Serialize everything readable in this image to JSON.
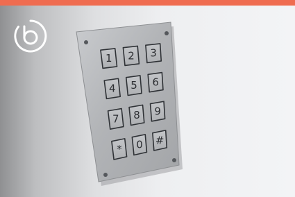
{
  "keypad": {
    "keys": [
      {
        "label": "1"
      },
      {
        "label": "2"
      },
      {
        "label": "3"
      },
      {
        "label": "4"
      },
      {
        "label": "5"
      },
      {
        "label": "6"
      },
      {
        "label": "7"
      },
      {
        "label": "8"
      },
      {
        "label": "9"
      },
      {
        "label": "*"
      },
      {
        "label": "0"
      },
      {
        "label": "#"
      }
    ]
  },
  "colors": {
    "accent": "#ef6c50",
    "logo": "#ffffff",
    "panel": "#b9bbbe",
    "background": "#eeeff1"
  },
  "logo": {
    "icon": "circular-b-logo-icon"
  }
}
